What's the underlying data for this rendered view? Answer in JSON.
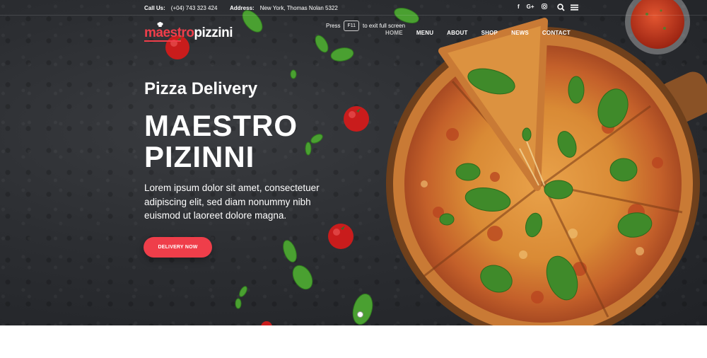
{
  "topbar": {
    "call_label": "Call Us:",
    "call_value": "(+04) 743 323 424",
    "address_label": "Address:",
    "address_value": "New York, Thomas Nolan 5322",
    "social": [
      "f",
      "G+"
    ]
  },
  "logo": {
    "part1": "maestro",
    "part2": "pizzini"
  },
  "fullscreen_tip": {
    "before": "Press",
    "key": "F11",
    "after": "to exit full screen"
  },
  "nav": {
    "items": [
      "HOME",
      "MENU",
      "ABOUT",
      "SHOP",
      "NEWS",
      "CONTACT"
    ]
  },
  "hero": {
    "kicker": "Pizza Delivery",
    "title_line1": "MAESTRO",
    "title_line2": "PIZINNI",
    "description": "Lorem ipsum dolor sit amet, consectetuer adipiscing elit, sed diam nonummy nibh euismod ut laoreet dolore magna.",
    "cta": "DELIVERY NOW"
  },
  "icons": [
    "instagram-icon",
    "search-icon",
    "menu-icon",
    "chef-hat-icon"
  ],
  "colors": {
    "accent": "#ef3e4a",
    "background": "#2c2e32",
    "text": "#ffffff"
  }
}
